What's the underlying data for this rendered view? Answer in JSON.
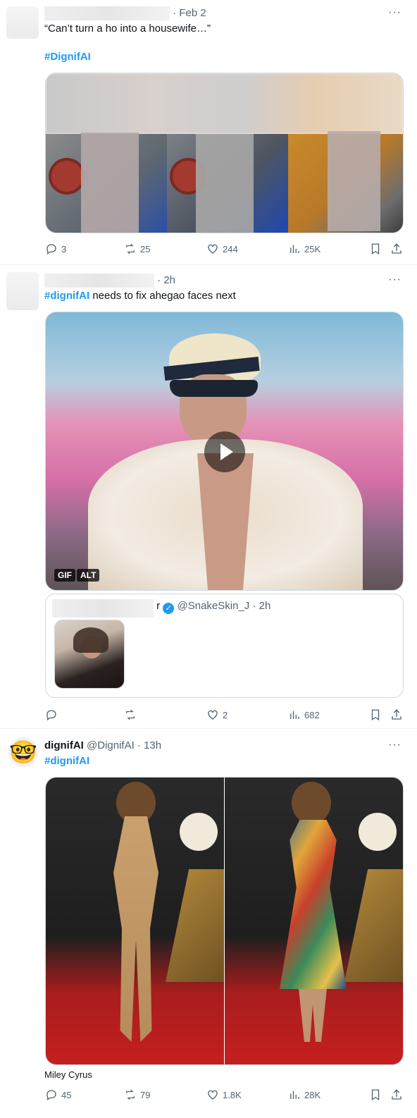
{
  "tweet1": {
    "time": "· Feb 2",
    "more": "···",
    "quote_text": "“Can’t turn a ho into a housewife…”",
    "hashtag": "#DignifAI",
    "stats": {
      "replies": "3",
      "reposts": "25",
      "likes": "244",
      "views": "25K"
    }
  },
  "tweet2": {
    "time": "· 2h",
    "more": "···",
    "hashtag": "#dignifAI",
    "text": " needs to fix ahegao faces next",
    "gif_badge": "GIF",
    "alt_badge": "ALT",
    "quoted": {
      "name_suffix": "r",
      "handle": "@SnakeSkin_J",
      "time": "· 2h"
    },
    "stats": {
      "replies": "",
      "reposts": "",
      "likes": "2",
      "views": "682"
    }
  },
  "tweet3": {
    "avatar_emoji": "🤓",
    "name": "dignifAI",
    "handle": "@DignifAI",
    "time": "· 13h",
    "more": "···",
    "hashtag": "#dignifAI",
    "caption": "Miley Cyrus",
    "stats": {
      "replies": "45",
      "reposts": "79",
      "likes": "1.8K",
      "views": "28K"
    }
  },
  "colors": {
    "link": "#1d9bf0",
    "muted": "#536471",
    "border": "#cfd9de",
    "verified": "#1d9bf0"
  },
  "icons": [
    "reply-icon",
    "repost-icon",
    "like-icon",
    "views-icon",
    "bookmark-icon",
    "share-icon",
    "play-icon",
    "verified-icon"
  ]
}
